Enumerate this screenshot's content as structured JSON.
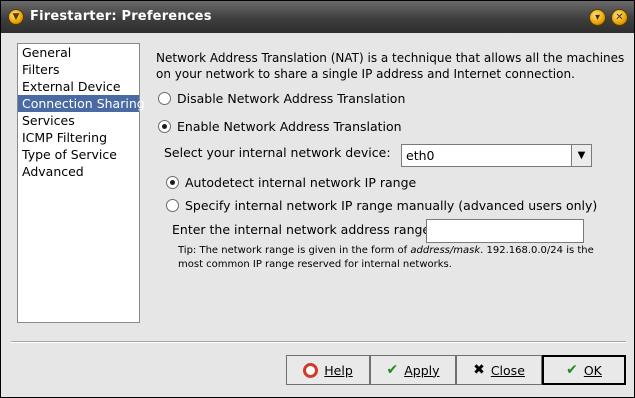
{
  "window": {
    "title": "Firestarter: Preferences",
    "minimize_glyph": "▾",
    "close_glyph": "✕"
  },
  "sidebar": {
    "items": [
      {
        "label": "General",
        "selected": false
      },
      {
        "label": "Filters",
        "selected": false
      },
      {
        "label": "External Device",
        "selected": false
      },
      {
        "label": "Connection Sharing",
        "selected": true
      },
      {
        "label": "Services",
        "selected": false
      },
      {
        "label": "ICMP Filtering",
        "selected": false
      },
      {
        "label": "Type of Service",
        "selected": false
      },
      {
        "label": "Advanced",
        "selected": false
      }
    ]
  },
  "nat": {
    "intro_line1": "Network Address Translation (NAT) is a technique that allows all the machines",
    "intro_line2": "on your network to share a single IP address and Internet connection.",
    "disable_label": "Disable Network Address Translation",
    "enable_label": "Enable Network Address Translation",
    "enabled": true,
    "device_label": "Select your internal network device:",
    "device_value": "eth0",
    "autodetect_label": "Autodetect internal network IP range",
    "manual_label": "Specify internal network IP range manually (advanced users only)",
    "autodetect_selected": true,
    "range_label": "Enter the internal network address range:",
    "range_value": "",
    "tip_prefix": "Tip: The network range is given in the form of ",
    "tip_form": "address/mask",
    "tip_suffix": ". 192.168.0.0/24 is the",
    "tip_line2": "most common IP range reserved for internal networks."
  },
  "buttons": {
    "help": "Help",
    "apply": "Apply",
    "close": "Close",
    "ok": "OK"
  },
  "icons": {
    "window": "firestarter-icon",
    "help": "lifebuoy-icon",
    "apply": "checkmark-icon",
    "close": "x-icon",
    "ok": "checkmark-icon"
  },
  "colors": {
    "selection": "#4a6aa4",
    "titlebar": "#3e3e3e",
    "help_ring": "#d23a2a",
    "check": "#1f8a1f"
  }
}
